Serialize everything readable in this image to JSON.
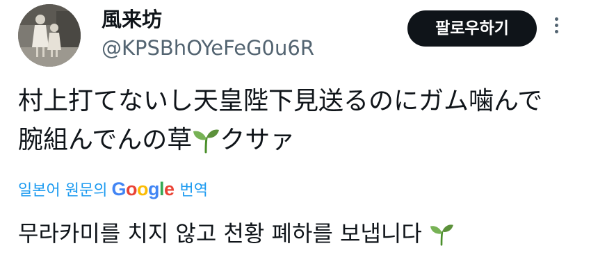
{
  "user": {
    "display_name": "風来坊",
    "handle": "@KPSBhOYeFeG0u6R"
  },
  "follow_button": {
    "label": "팔로우하기"
  },
  "tweet": {
    "line1": "村上打てないし天皇陛下見送るのにガム噛んで",
    "line2_before_emoji": "腕組んでんの草",
    "line2_after_emoji": "クサァ"
  },
  "translation": {
    "prefix": "일본어 원문의",
    "brand": "Google",
    "suffix": "번역",
    "text": "무라카미를 치지 않고 천황 폐하를 보냅니다"
  },
  "icons": {
    "emoji": "seedling-icon",
    "menu": "more-vertical-icon"
  },
  "colors": {
    "accent": "#1d9bf0",
    "text_primary": "#0f1419",
    "text_secondary": "#536471",
    "button_bg": "#0f1419"
  }
}
